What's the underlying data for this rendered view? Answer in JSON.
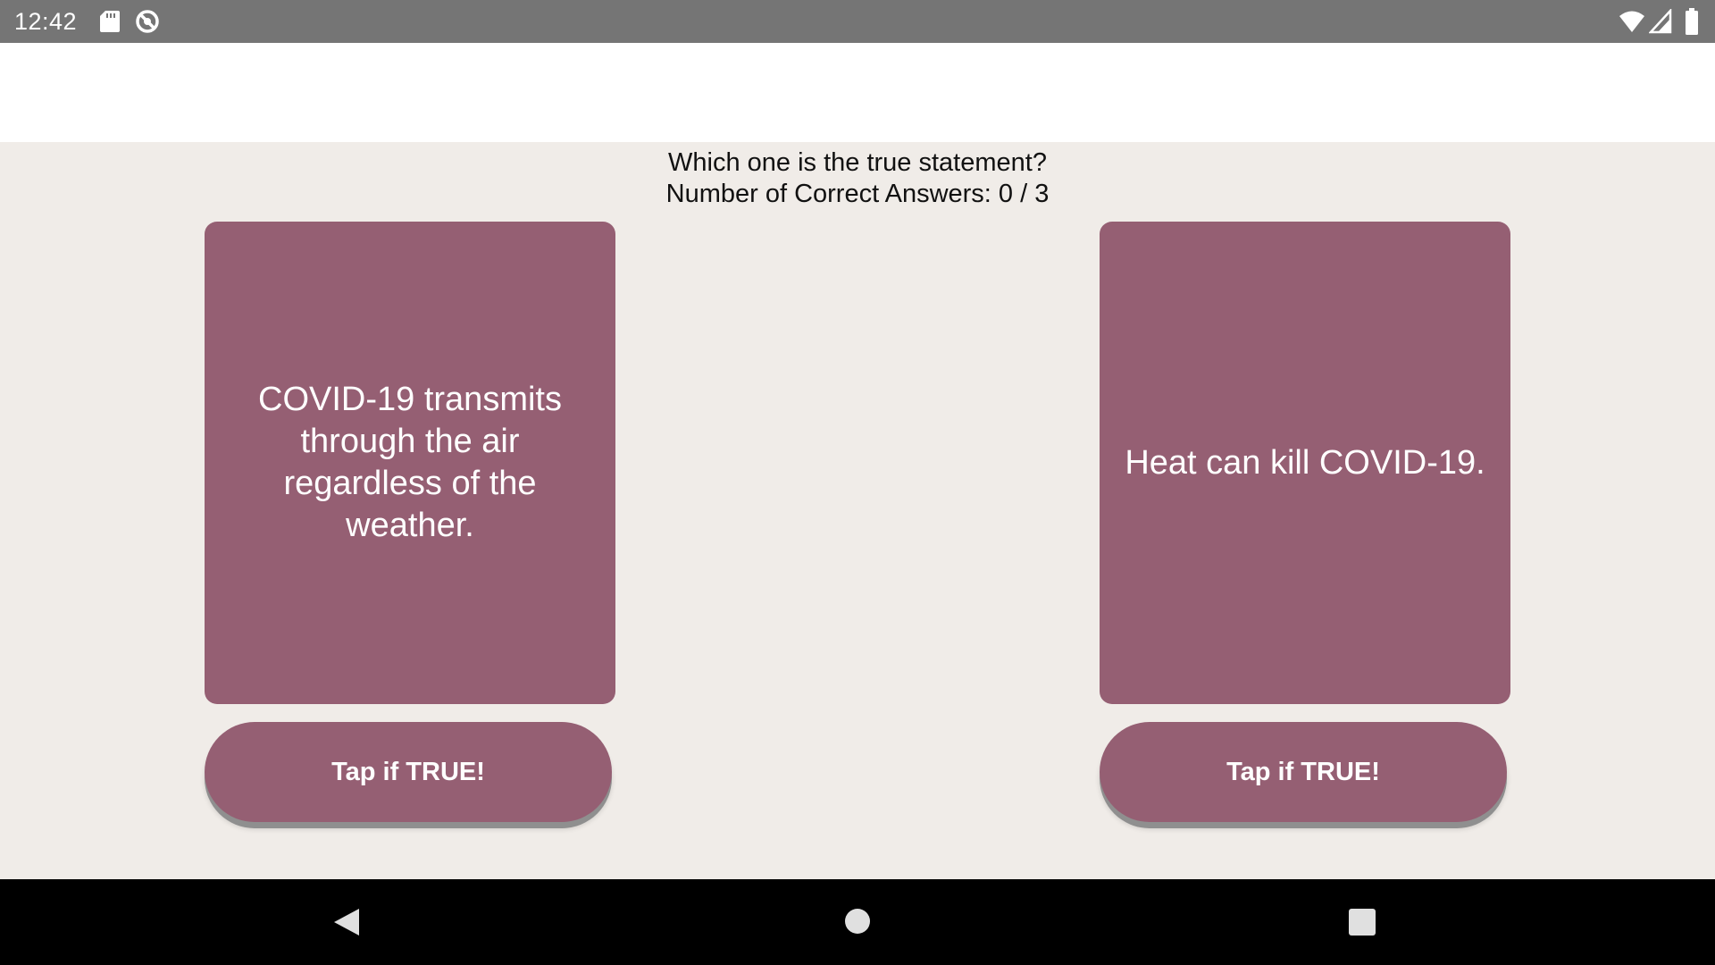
{
  "status_bar": {
    "time": "12:42",
    "icons": [
      "sd-card-icon",
      "sync-icon",
      "wifi-icon",
      "cell-signal-icon",
      "battery-icon"
    ]
  },
  "quiz": {
    "question": "Which one is the true statement?",
    "score_text": "Number of Correct Answers: 0 / 3",
    "options": [
      {
        "statement": "COVID-19 transmits through the air regardless of the weather.",
        "button_label": "Tap if TRUE!"
      },
      {
        "statement": "Heat can kill COVID-19.",
        "button_label": "Tap if TRUE!"
      }
    ]
  },
  "nav_bar": {
    "icons": [
      "back-icon",
      "home-icon",
      "recents-icon"
    ]
  },
  "colors": {
    "accent": "#955f73",
    "background": "#f0ece8",
    "status_bar": "#757575",
    "nav_bar": "#000000"
  }
}
